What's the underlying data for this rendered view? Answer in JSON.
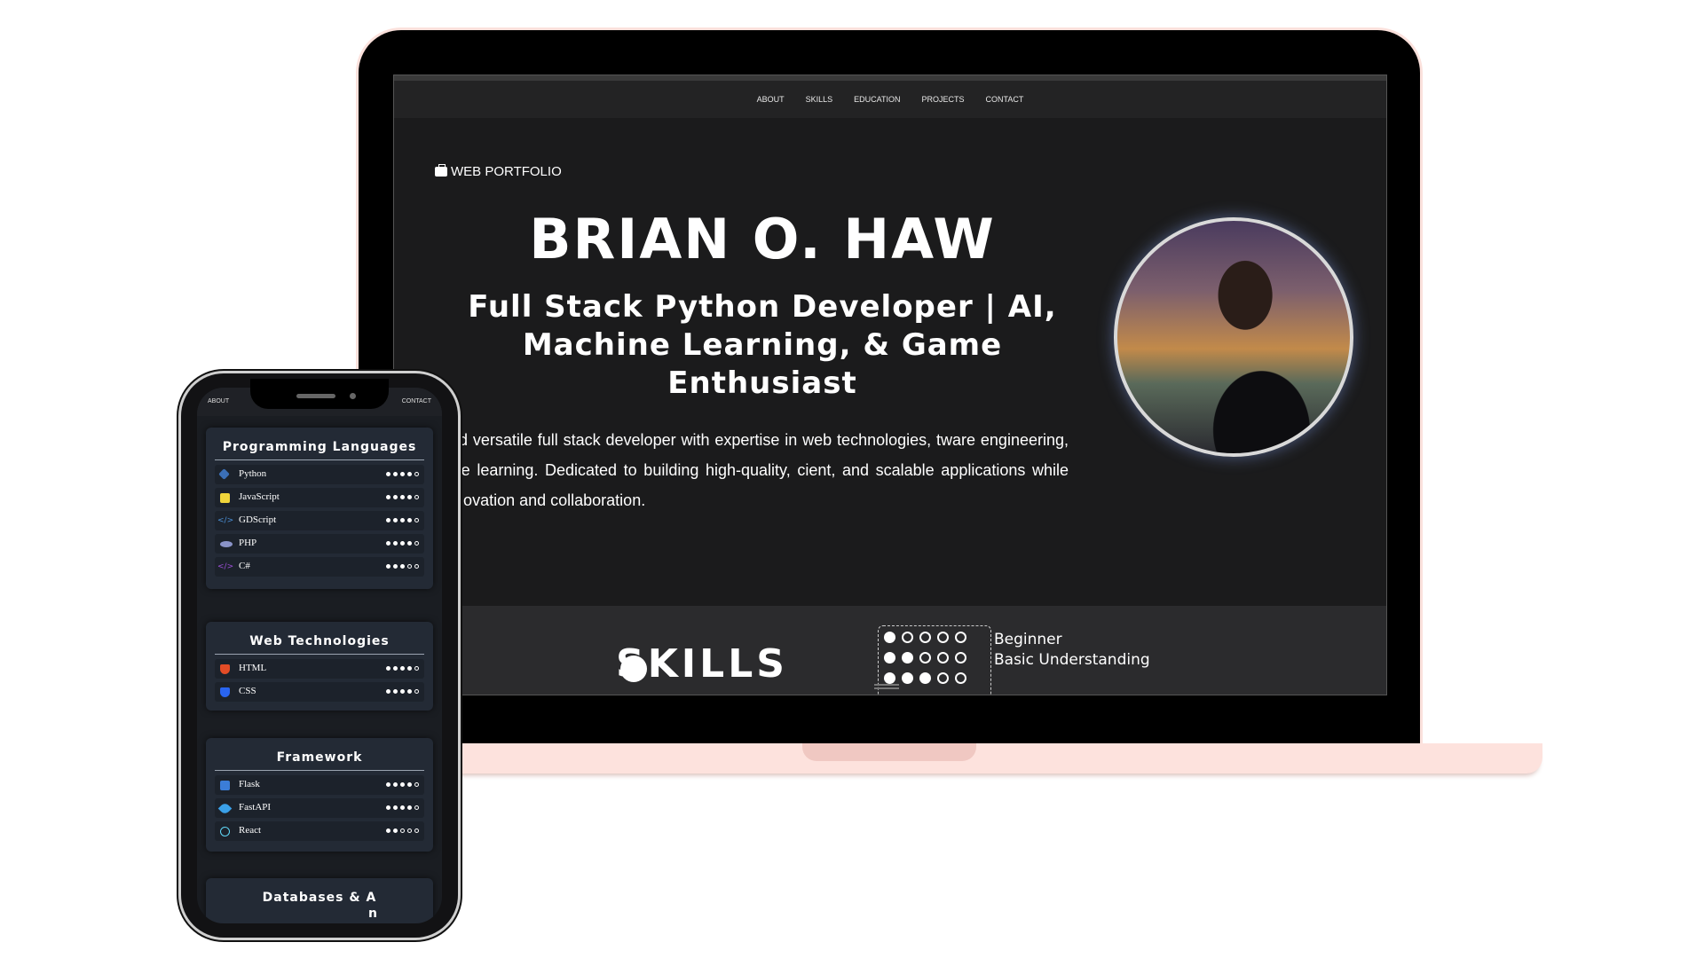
{
  "laptop": {
    "nav": [
      "ABOUT",
      "SKILLS",
      "EDUCATION",
      "PROJECTS",
      "CONTACT"
    ],
    "eyebrow": "WEB PORTFOLIO",
    "name": "BRIAN O. HAW",
    "title": "Full Stack Python Developer | AI, Machine Learning, & Game Enthusiast",
    "description": "ssionate and versatile full stack developer with expertise in web technologies, tware engineering, and machine learning. Dedicated to building high-quality, cient, and scalable applications while fostering innovation and collaboration.",
    "skills_heading": "SKILLS",
    "legend": [
      {
        "label": "Beginner",
        "level": 1
      },
      {
        "label": "Basic Understanding",
        "level": 2
      }
    ]
  },
  "phone": {
    "nav_left": "ABOUT",
    "nav_right": "CONTACT",
    "cards": [
      {
        "title": "Programming Languages",
        "items": [
          {
            "name": "Python",
            "level": 4,
            "icon": "python-icon",
            "color": "#3b6fb6"
          },
          {
            "name": "JavaScript",
            "level": 4,
            "icon": "javascript-icon",
            "color": "#f0d53b"
          },
          {
            "name": "GDScript",
            "level": 4,
            "icon": "code-icon",
            "color": "#4a8fd6"
          },
          {
            "name": "PHP",
            "level": 4,
            "icon": "php-icon",
            "color": "#8a93c8"
          },
          {
            "name": "C#",
            "level": 3,
            "icon": "code-icon",
            "color": "#9b4fd6"
          }
        ]
      },
      {
        "title": "Web Technologies",
        "items": [
          {
            "name": "HTML",
            "level": 4,
            "icon": "html-icon",
            "color": "#e34c26"
          },
          {
            "name": "CSS",
            "level": 4,
            "icon": "css-icon",
            "color": "#2965f1"
          }
        ]
      },
      {
        "title": "Framework",
        "items": [
          {
            "name": "Flask",
            "level": 4,
            "icon": "flask-icon",
            "color": "#3b7dd8"
          },
          {
            "name": "FastAPI",
            "level": 4,
            "icon": "rocket-icon",
            "color": "#3aa0e8"
          },
          {
            "name": "React",
            "level": 2,
            "icon": "react-icon",
            "color": "#61dafb"
          }
        ]
      },
      {
        "title": "Databases & A",
        "title_line2": "n",
        "items": []
      }
    ]
  }
}
